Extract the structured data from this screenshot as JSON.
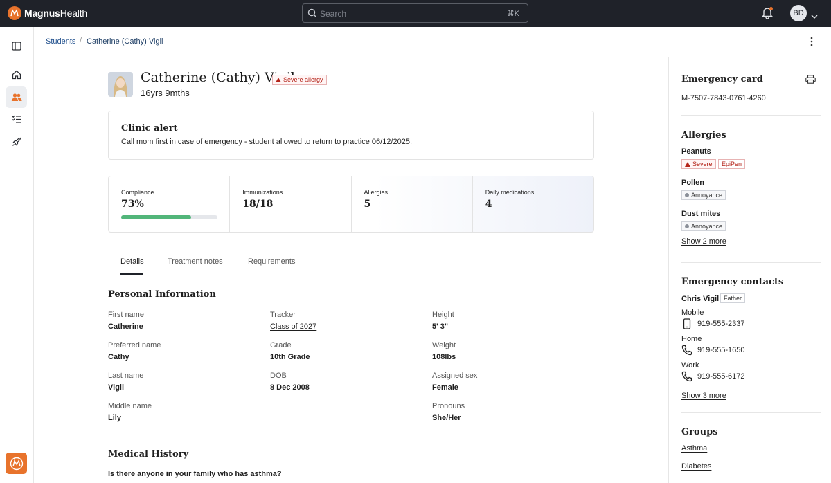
{
  "app": {
    "brand_prefix": "Magnus",
    "brand_suffix": "Health",
    "search_placeholder": "Search",
    "search_shortcut": "⌘K",
    "user_initials": "BD"
  },
  "breadcrumb": {
    "root": "Students",
    "current": "Catherine (Cathy) Vigil"
  },
  "student": {
    "name": "Catherine (Cathy) Vigil",
    "age": "16yrs 9mths",
    "badge": "Severe allergy"
  },
  "clinic_alert": {
    "title": "Clinic alert",
    "text": "Call mom first in case of emergency - student allowed to return to practice 06/12/2025."
  },
  "stats": {
    "compliance_label": "Compliance",
    "compliance_value": "73%",
    "compliance_fraction": 0.73,
    "immunizations_label": "Immunizations",
    "immunizations_value": "18/18",
    "allergies_label": "Allergies",
    "allergies_value": "5",
    "medications_label": "Daily medications",
    "medications_value": "4"
  },
  "tabs": [
    "Details",
    "Treatment notes",
    "Requirements"
  ],
  "personal": {
    "title": "Personal Information",
    "first_name_label": "First name",
    "first_name": "Catherine",
    "preferred_name_label": "Preferred name",
    "preferred_name": "Cathy",
    "last_name_label": "Last name",
    "last_name": "Vigil",
    "middle_name_label": "Middle name",
    "middle_name": "Lily",
    "tracker_label": "Tracker",
    "tracker": "Class of 2027",
    "grade_label": "Grade",
    "grade": "10th Grade",
    "dob_label": "DOB",
    "dob": "8 Dec 2008",
    "height_label": "Height",
    "height": "5' 3\"",
    "weight_label": "Weight",
    "weight": "108lbs",
    "sex_label": "Assigned sex",
    "sex": "Female",
    "pronouns_label": "Pronouns",
    "pronouns": "She/Her"
  },
  "medical": {
    "title": "Medical History",
    "question": "Is there anyone in your family who has asthma?"
  },
  "emergency_card": {
    "title": "Emergency card",
    "number": "M-7507-7843-0761-4260"
  },
  "allergies": {
    "title": "Allergies",
    "items": [
      {
        "name": "Peanuts",
        "tag": "Severe",
        "extra": "EpiPen"
      },
      {
        "name": "Pollen",
        "tag": "Annoyance"
      },
      {
        "name": "Dust mites",
        "tag": "Annoyance"
      }
    ],
    "more": "Show 2 more"
  },
  "contacts": {
    "title": "Emergency contacts",
    "name": "Chris Vigil",
    "relation": "Father",
    "mobile_label": "Mobile",
    "mobile": "919-555-2337",
    "home_label": "Home",
    "home": "919-555-1650",
    "work_label": "Work",
    "work": "919-555-6172",
    "more": "Show 3 more"
  },
  "groups": {
    "title": "Groups",
    "items": [
      "Asthma",
      "Diabetes"
    ]
  },
  "colors": {
    "topbar": "#1f2229",
    "accent": "#e8732c",
    "link": "#1e4e8c",
    "danger": "#b42318",
    "progress": "#52b67a"
  }
}
